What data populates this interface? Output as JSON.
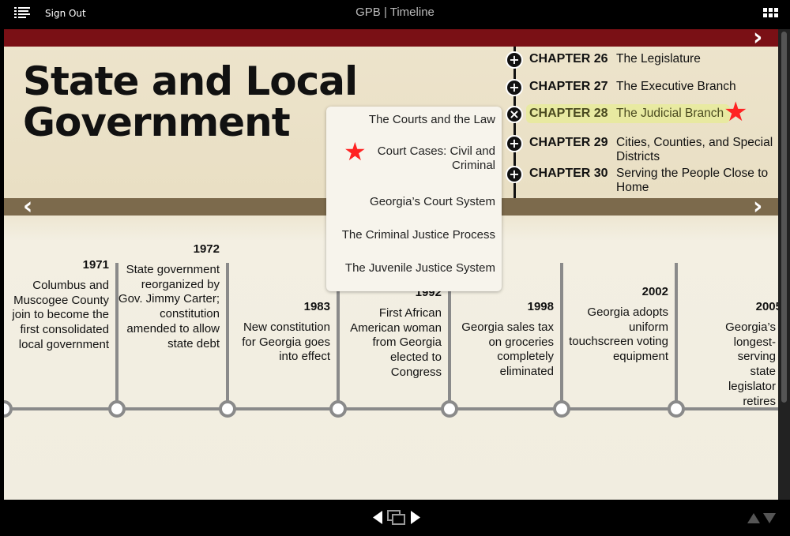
{
  "header": {
    "title": "GPB | Timeline",
    "sign_out": "Sign Out",
    "menu_icon": "list-icon",
    "apps_icon": "grid-icon"
  },
  "colors": {
    "top_bar": "#7a1015",
    "mid_bar": "#7c6a4c",
    "highlight": "#e6f082",
    "star": "#ff2222"
  },
  "page_title_line1": "State and Local",
  "page_title_line2": "Government",
  "chapters": [
    {
      "number": "CHAPTER 26",
      "name": "The Legislature",
      "icon": "plus-icon"
    },
    {
      "number": "CHAPTER 27",
      "name": "The Executive Branch",
      "icon": "plus-icon"
    },
    {
      "number": "CHAPTER 28",
      "name": "The Judicial Branch",
      "icon": "close-icon",
      "active": true,
      "starred": true
    },
    {
      "number": "CHAPTER 29",
      "name": "Cities, Counties, and Special Districts",
      "icon": "plus-icon"
    },
    {
      "number": "CHAPTER 30",
      "name": "Serving the People Close to Home",
      "icon": "plus-icon"
    }
  ],
  "sections": [
    {
      "label": "The Courts and the Law"
    },
    {
      "label": "Court Cases: Civil and Criminal",
      "starred": true
    },
    {
      "label": "Georgia’s Court System"
    },
    {
      "label": "The Criminal Justice Process"
    },
    {
      "label": "The Juvenile Justice System"
    }
  ],
  "events": [
    {
      "year": "1971",
      "text": "Columbus and Muscogee County join to become the first consolidated local government"
    },
    {
      "year": "1972",
      "text": "State government reorganized by Gov. Jimmy Carter; constitution amended to allow state debt"
    },
    {
      "year": "1983",
      "text": "New constitution for Georgia goes into effect"
    },
    {
      "year": "1992",
      "text": "First African American woman from Georgia elected to Congress"
    },
    {
      "year": "1998",
      "text": "Georgia sales tax on groceries completely eliminated"
    },
    {
      "year": "2002",
      "text": "Georgia adopts uniform touchscreen voting equipment"
    },
    {
      "year": "2005",
      "text": "Georgia’s longest-serving state legislator retires"
    }
  ],
  "footer": {
    "prev_icon": "triangle-left-icon",
    "windows_icon": "windows-icon",
    "next_icon": "triangle-right-icon",
    "up_icon": "triangle-up-icon",
    "down_icon": "triangle-down-icon"
  }
}
